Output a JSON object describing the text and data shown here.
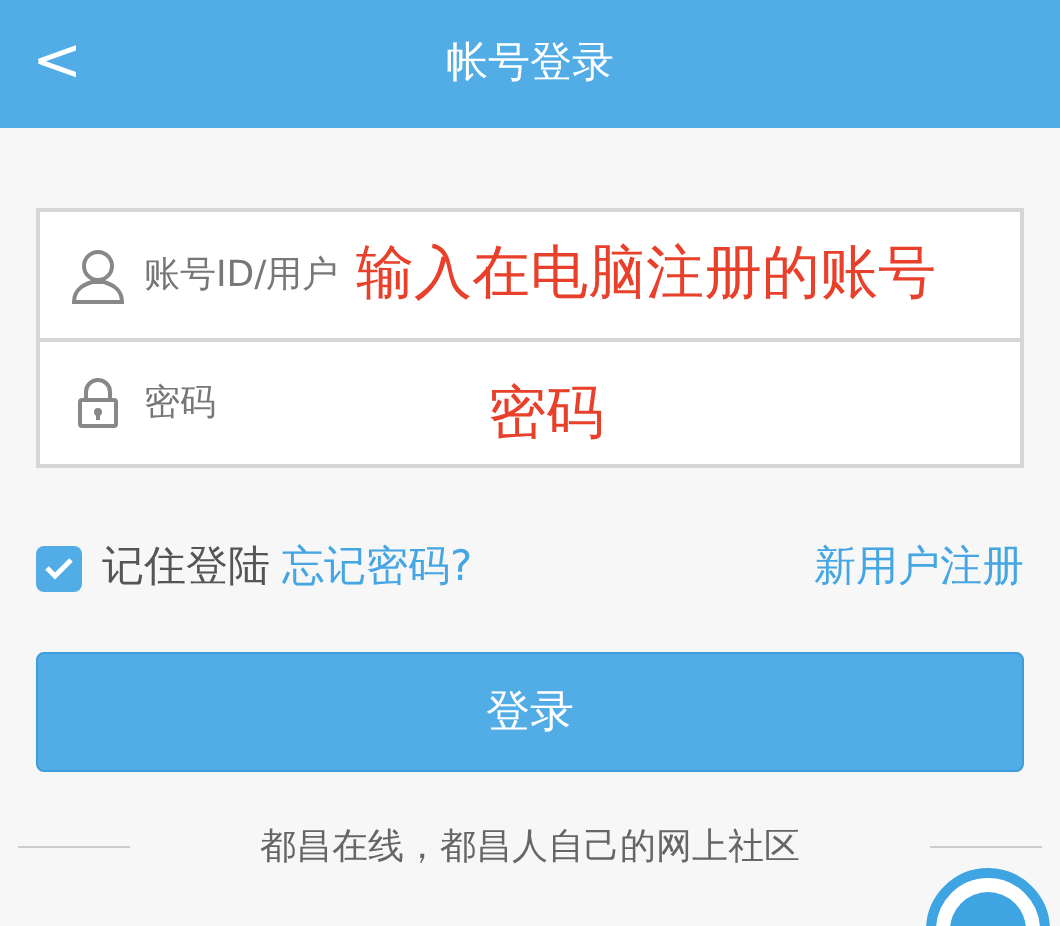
{
  "header": {
    "back": "<",
    "title": "帐号登录"
  },
  "fields": [
    {
      "kind": "user",
      "placeholder": "账号ID/用户"
    },
    {
      "kind": "lock",
      "placeholder": "密码"
    }
  ],
  "annotations": [
    "输入在电脑注册的账号",
    "密码"
  ],
  "remember": {
    "label": "记住登陆",
    "checked": true
  },
  "forgot_link": "忘记密码?",
  "register_link": "新用户注册",
  "login_button": "登录",
  "footer": "都昌在线，都昌人自己的网上社区"
}
